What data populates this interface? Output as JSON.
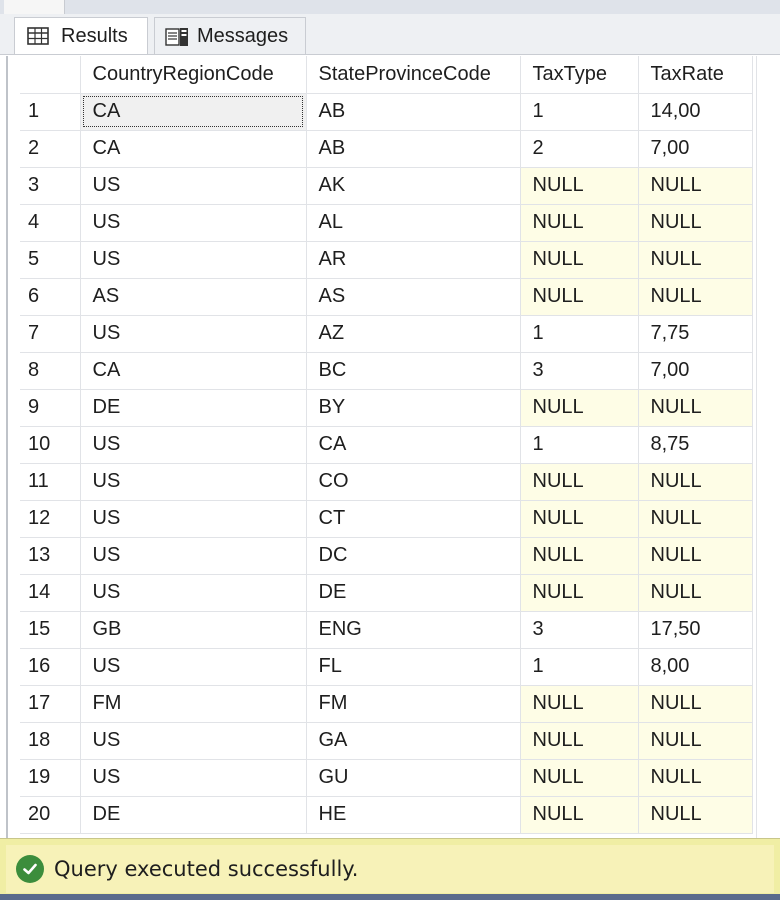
{
  "tabs": {
    "results_label": "Results",
    "messages_label": "Messages"
  },
  "grid": {
    "columns": [
      "",
      "CountryRegionCode",
      "StateProvinceCode",
      "TaxType",
      "TaxRate"
    ],
    "rows": [
      [
        "1",
        "CA",
        "AB",
        "1",
        "14,00"
      ],
      [
        "2",
        "CA",
        "AB",
        "2",
        "7,00"
      ],
      [
        "3",
        "US",
        "AK",
        "NULL",
        "NULL"
      ],
      [
        "4",
        "US",
        "AL",
        "NULL",
        "NULL"
      ],
      [
        "5",
        "US",
        "AR",
        "NULL",
        "NULL"
      ],
      [
        "6",
        "AS",
        "AS",
        "NULL",
        "NULL"
      ],
      [
        "7",
        "US",
        "AZ",
        "1",
        "7,75"
      ],
      [
        "8",
        "CA",
        "BC",
        "3",
        "7,00"
      ],
      [
        "9",
        "DE",
        "BY",
        "NULL",
        "NULL"
      ],
      [
        "10",
        "US",
        "CA",
        "1",
        "8,75"
      ],
      [
        "11",
        "US",
        "CO",
        "NULL",
        "NULL"
      ],
      [
        "12",
        "US",
        "CT",
        "NULL",
        "NULL"
      ],
      [
        "13",
        "US",
        "DC",
        "NULL",
        "NULL"
      ],
      [
        "14",
        "US",
        "DE",
        "NULL",
        "NULL"
      ],
      [
        "15",
        "GB",
        "ENG",
        "3",
        "17,50"
      ],
      [
        "16",
        "US",
        "FL",
        "1",
        "8,00"
      ],
      [
        "17",
        "FM",
        "FM",
        "NULL",
        "NULL"
      ],
      [
        "18",
        "US",
        "GA",
        "NULL",
        "NULL"
      ],
      [
        "19",
        "US",
        "GU",
        "NULL",
        "NULL"
      ],
      [
        "20",
        "DE",
        "HE",
        "NULL",
        "NULL"
      ]
    ]
  },
  "status": {
    "text": "Query executed successfully.",
    "icon": "check-circle-icon",
    "color": "#3c8d3c"
  }
}
